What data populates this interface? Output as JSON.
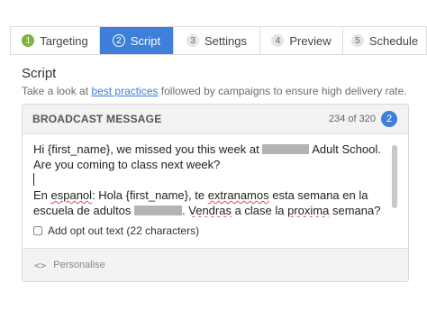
{
  "tabs": [
    {
      "num": "1",
      "label": "Targeting",
      "state": "done"
    },
    {
      "num": "2",
      "label": "Script",
      "state": "active"
    },
    {
      "num": "3",
      "label": "Settings",
      "state": "pending"
    },
    {
      "num": "4",
      "label": "Preview",
      "state": "pending"
    },
    {
      "num": "5",
      "label": "Schedule",
      "state": "pending"
    }
  ],
  "section": {
    "title": "Script",
    "desc_before": "Take a look at ",
    "desc_link": "best practices",
    "desc_after": " followed by campaigns to ensure high delivery rate."
  },
  "card": {
    "title": "BROADCAST MESSAGE",
    "char_count": "234 of 320",
    "segments": "2"
  },
  "message": {
    "line1_a": "Hi {first_name}, we missed you this week at ",
    "line1_b": " Adult School. Are you coming to class next week?",
    "es_a": "En ",
    "es_b": "espanol",
    "es_c": ": Hola {first_name}, te ",
    "es_d": "extranamos",
    "es_e": " esta semana en la escuela de adultos ",
    "es_f": ". ",
    "es_g": "Vendras",
    "es_h": " a clase la ",
    "es_i": "proxima",
    "es_j": " semana?"
  },
  "optout": {
    "label": "Add opt out text (22 characters)",
    "checked": false
  },
  "footer": {
    "icon_text": "<>",
    "label": "Personalise"
  },
  "colors": {
    "accent": "#3d7fd9",
    "done": "#7fb241"
  }
}
